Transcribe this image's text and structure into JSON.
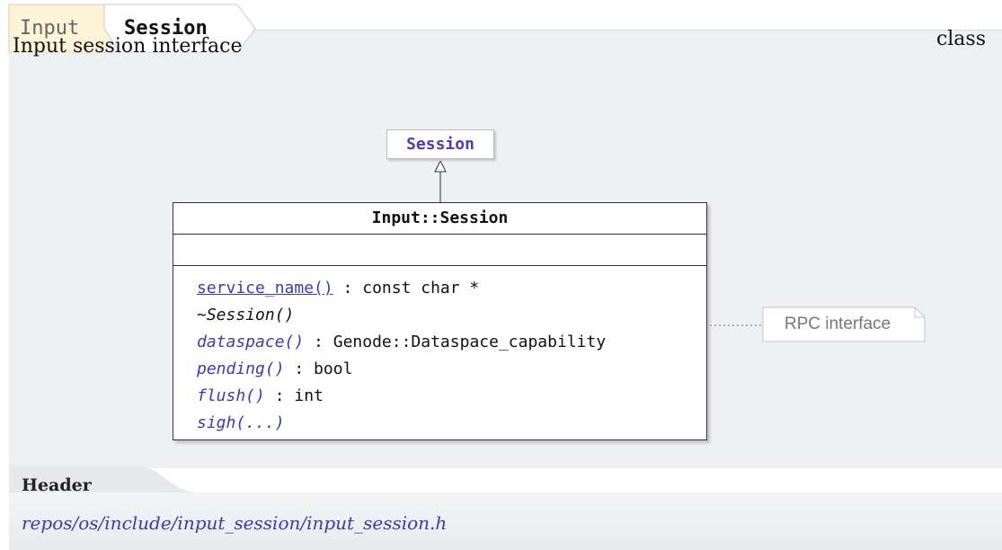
{
  "breadcrumb": {
    "parent": "Input",
    "current": "Session"
  },
  "panel": {
    "description": "Input session interface",
    "kind": "class"
  },
  "diagram": {
    "base_class": "Session",
    "class_name": "Input::Session",
    "operations": [
      {
        "name": "service_name()",
        "type": " : const char *"
      },
      {
        "name": "~Session()",
        "type": ""
      },
      {
        "name": "dataspace()",
        "type": " : Genode::Dataspace_capability"
      },
      {
        "name": "pending()",
        "type": " : bool"
      },
      {
        "name": "flush()",
        "type": " : int"
      },
      {
        "name": "sigh(...)",
        "type": ""
      }
    ],
    "note": "RPC interface"
  },
  "header": {
    "title": "Header",
    "path": "repos/os/include/input_session/input_session.h"
  }
}
